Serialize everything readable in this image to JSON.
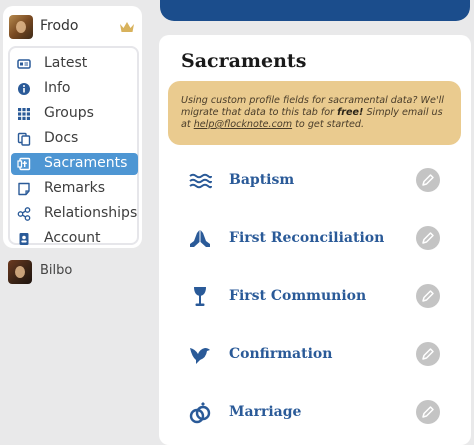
{
  "sidebar": {
    "current_user": {
      "name": "Frodo",
      "avatar_icon": "avatar-photo",
      "badge_icon": "crown-icon"
    },
    "menu": [
      {
        "label": "Latest",
        "icon": "id-card-icon",
        "active": false
      },
      {
        "label": "Info",
        "icon": "info-icon",
        "active": false
      },
      {
        "label": "Groups",
        "icon": "groups-grid-icon",
        "active": false
      },
      {
        "label": "Docs",
        "icon": "docs-copy-icon",
        "active": false
      },
      {
        "label": "Sacraments",
        "icon": "sacraments-icon",
        "active": true
      },
      {
        "label": "Remarks",
        "icon": "note-icon",
        "active": false
      },
      {
        "label": "Relationships",
        "icon": "share-nodes-icon",
        "active": false
      },
      {
        "label": "Account",
        "icon": "account-badge-icon",
        "active": false
      }
    ],
    "other_user": {
      "name": "Bilbo",
      "avatar_icon": "avatar-photo"
    }
  },
  "main": {
    "title": "Sacraments",
    "notice": {
      "text_before": "Using custom profile fields for sacramental data? We'll migrate that data to this tab for ",
      "text_bold": "free!",
      "text_middle": " Simply email us at ",
      "email": "help@flocknote.com",
      "text_after": " to get started."
    },
    "sacraments": [
      {
        "label": "Baptism",
        "icon": "water-waves-icon"
      },
      {
        "label": "First Reconciliation",
        "icon": "praying-hands-icon"
      },
      {
        "label": "First Communion",
        "icon": "chalice-icon"
      },
      {
        "label": "Confirmation",
        "icon": "dove-icon"
      },
      {
        "label": "Marriage",
        "icon": "rings-icon"
      }
    ],
    "edit_icon": "pencil-icon"
  },
  "colors": {
    "accent": "#4e96d3",
    "banner": "#1b4d8c",
    "notice_bg": "#eacb8f",
    "sacrament_text": "#2a5a98",
    "edit_btn": "#c4c4c4",
    "crown": "#d8b25c"
  }
}
